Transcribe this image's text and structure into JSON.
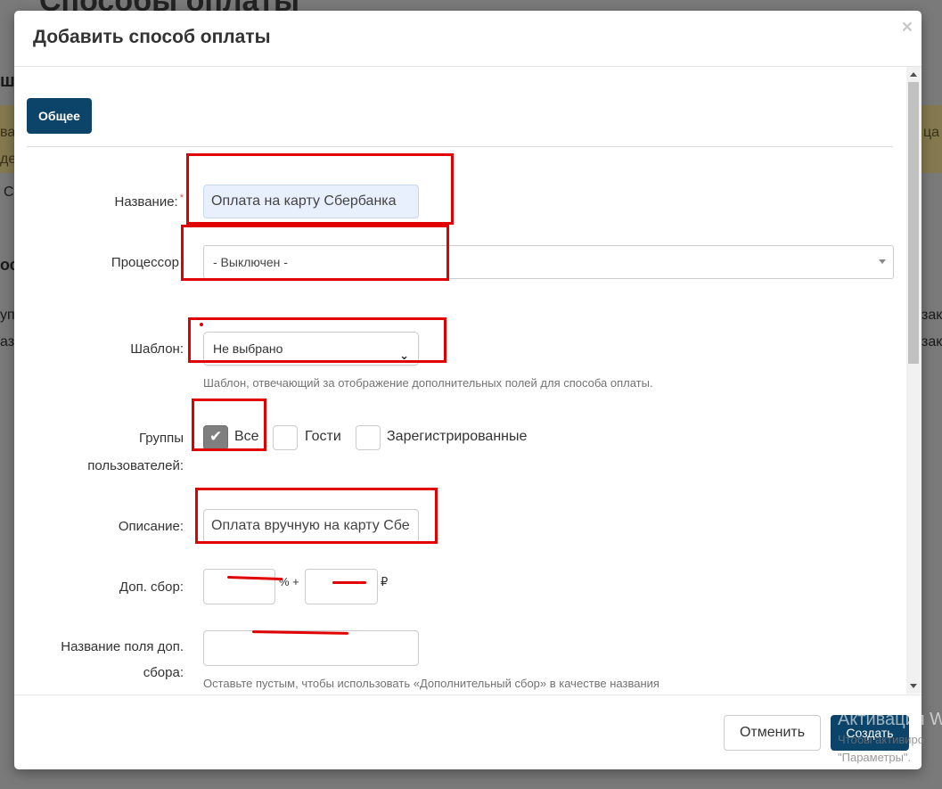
{
  "background": {
    "page_title": "Способы оплаты",
    "fragments": [
      "ш",
      "ва",
      "де",
      "С",
      "ос",
      "уп",
      "аз",
      "ца",
      "зак",
      "зак"
    ]
  },
  "modal": {
    "title": "Добавить способ оплаты",
    "close_symbol": "×",
    "tab_general": "Общее",
    "fields": {
      "name_label": "Название:",
      "name_required": "*",
      "name_value": "Оплата на карту Сбербанка",
      "processor_label": "Процессор",
      "processor_value": "- Выключен -",
      "template_label": "Шаблон:",
      "template_value": "Не выбрано",
      "template_help": "Шаблон, отвечающий за отображение дополнительных полей для способа оплаты.",
      "groups_label_line1": "Группы",
      "groups_label_line2": "пользователей:",
      "groups": [
        {
          "label": "Все",
          "checked": true
        },
        {
          "label": "Гости",
          "checked": false
        },
        {
          "label": "Зарегистрированные",
          "checked": false
        }
      ],
      "description_label": "Описание:",
      "description_value": "Оплата вручную на карту Сбе",
      "fee_label": "Доп. сбор:",
      "fee_percent_unit": "% +",
      "fee_currency_unit": "₽",
      "fee_name_label_line1": "Название поля доп.",
      "fee_name_label_line2": "сбора:",
      "fee_name_help": "Оставьте пустым, чтобы использовать «Дополнительный сбор» в качестве названия"
    },
    "footer": {
      "cancel_label": "Отменить",
      "create_label": "Создать"
    }
  },
  "watermark": {
    "title": "Активация W",
    "line1": "Чтобы активиро",
    "line2": "\"Параметры\"."
  },
  "colors": {
    "primary": "#0c4469",
    "annotation": "#e00000",
    "checked_box": "#7f7f7f"
  }
}
